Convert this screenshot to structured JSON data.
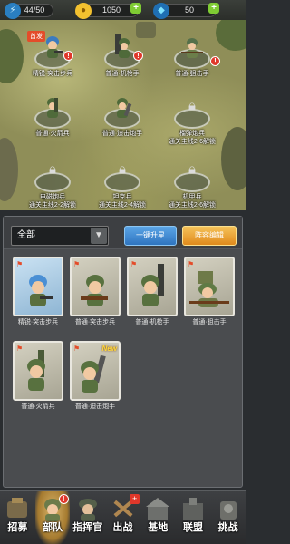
{
  "resources": [
    {
      "name": "stamina",
      "icon": "lightning-icon",
      "value": "44/50",
      "color": "#3fb8e8"
    },
    {
      "name": "gold",
      "icon": "coin-icon",
      "value": "1050",
      "color": "#f3c12f"
    },
    {
      "name": "diamond",
      "icon": "diamond-icon",
      "value": "50",
      "color": "#4fd0ff"
    }
  ],
  "map": {
    "head_badge": "首发",
    "nodes": [
      {
        "line1": "精锐·突击步兵",
        "line2": "",
        "locked": false
      },
      {
        "line1": "普通·机枪手",
        "line2": "",
        "locked": false
      },
      {
        "line1": "普通·狙击手",
        "line2": "",
        "locked": false
      },
      {
        "line1": "普通·火箭兵",
        "line2": "",
        "locked": false
      },
      {
        "line1": "普通·迫击炮手",
        "line2": "",
        "locked": false
      },
      {
        "line1": "榴弹炮兵",
        "line2": "通关主线2-6解锁",
        "locked": true
      },
      {
        "line1": "电磁炮兵",
        "line2": "通关主线2-2解锁",
        "locked": true
      },
      {
        "line1": "坦克兵",
        "line2": "通关主线2-4解锁",
        "locked": true
      },
      {
        "line1": "机甲兵",
        "line2": "通关主线2-6解锁",
        "locked": true
      }
    ]
  },
  "panel": {
    "filter": "全部",
    "upgrade_button": "一键升星",
    "lineup_button": "阵容编辑",
    "cards": [
      {
        "label": "精锐·突击步兵",
        "new": ""
      },
      {
        "label": "普通·突击步兵",
        "new": ""
      },
      {
        "label": "普通·机枪手",
        "new": ""
      },
      {
        "label": "普通·狙击手",
        "new": ""
      },
      {
        "label": "普通·火箭兵",
        "new": ""
      },
      {
        "label": "普通·迫击炮手",
        "new": "New"
      }
    ]
  },
  "nav": [
    {
      "label": "招募",
      "icon": "recruit-icon",
      "active": false
    },
    {
      "label": "部队",
      "icon": "troops-icon",
      "active": true
    },
    {
      "label": "指挥官",
      "icon": "commander-icon",
      "active": false
    },
    {
      "label": "出战",
      "icon": "battle-icon",
      "active": false
    },
    {
      "label": "基地",
      "icon": "base-icon",
      "active": false
    },
    {
      "label": "联盟",
      "icon": "alliance-icon",
      "active": false
    },
    {
      "label": "挑战",
      "icon": "challenge-icon",
      "active": false
    }
  ]
}
